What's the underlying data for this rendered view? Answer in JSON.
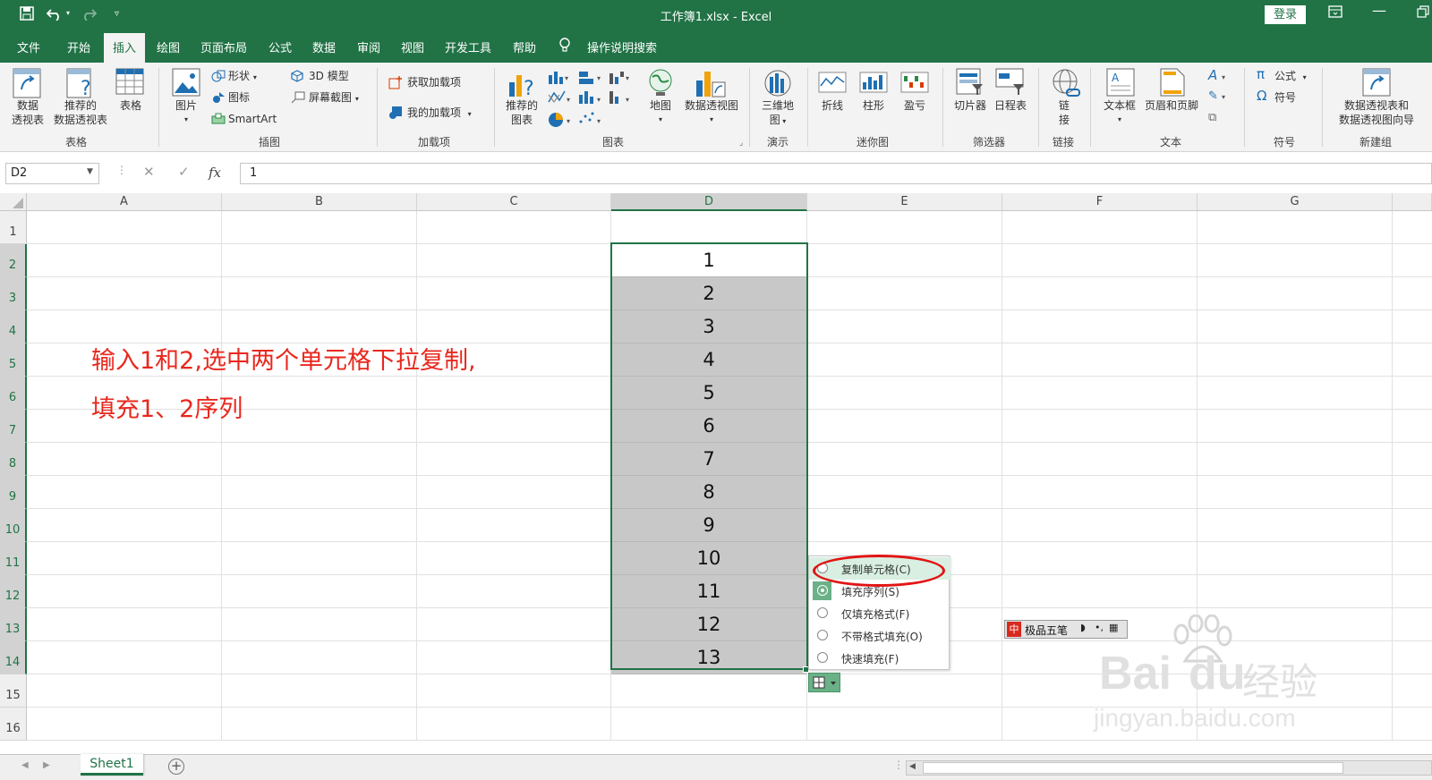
{
  "window": {
    "title": "工作簿1.xlsx  -  Excel",
    "login": "登录",
    "save_icon": "save-icon",
    "undo_icon": "undo-icon",
    "redo_icon": "redo-icon",
    "customize_icon": "customize-qat-icon"
  },
  "menu": {
    "tabs": [
      "文件",
      "开始",
      "插入",
      "绘图",
      "页面布局",
      "公式",
      "数据",
      "审阅",
      "视图",
      "开发工具",
      "帮助"
    ],
    "active": "插入",
    "tellme": "操作说明搜索"
  },
  "ribbon": {
    "groups": {
      "tables": "表格",
      "illustrations": "插图",
      "addins": "加载项",
      "charts": "图表",
      "tours": "演示",
      "sparklines": "迷你图",
      "filters": "筛选器",
      "links": "链接",
      "text": "文本",
      "symbols": "符号",
      "new_group": "新建组"
    },
    "pivot_table": [
      "数据",
      "透视表"
    ],
    "recommended_pivot": [
      "推荐的",
      "数据透视表"
    ],
    "table": "表格",
    "picture": "图片",
    "shapes": "形状",
    "icons": "图标",
    "smartart": "SmartArt",
    "model3d": "3D 模型",
    "screenshot": "屏幕截图",
    "get_addins": "获取加载项",
    "my_addins": "我的加载项",
    "recommended_charts": [
      "推荐的",
      "图表"
    ],
    "map": "地图",
    "pivot_chart": "数据透视图",
    "map3d": [
      "三维地",
      "图"
    ],
    "line": "折线",
    "column": "柱形",
    "winloss": "盈亏",
    "slicer": "切片器",
    "timeline": "日程表",
    "link": [
      "链",
      "接"
    ],
    "textbox": "文本框",
    "header_footer": "页眉和页脚",
    "equation": "公式",
    "symbol": "符号",
    "pivot_wizard": [
      "数据透视表和",
      "数据透视图向导"
    ]
  },
  "formula_bar": {
    "name_box": "D2",
    "cancel": "✕",
    "enter": "✓",
    "fx": "fx",
    "value": "1"
  },
  "grid": {
    "columns": [
      "A",
      "B",
      "C",
      "D",
      "E",
      "F",
      "G"
    ],
    "selected_column": "D",
    "rows": [
      "1",
      "2",
      "3",
      "4",
      "5",
      "6",
      "7",
      "8",
      "9",
      "10",
      "11",
      "12",
      "13",
      "14",
      "15",
      "16"
    ],
    "d_values": [
      "1",
      "2",
      "3",
      "4",
      "5",
      "6",
      "7",
      "8",
      "9",
      "10",
      "11",
      "12",
      "13"
    ]
  },
  "annotation": {
    "line1": "输入1和2,选中两个单元格下拉复制,",
    "line2": "填充1、2序列",
    "color": "#e8281e"
  },
  "autofill_menu": {
    "items": [
      "复制单元格(C)",
      "填充序列(S)",
      "仅填充格式(F)",
      "不带格式填充(O)",
      "快速填充(F)"
    ],
    "selected_index": 1,
    "highlighted_index": 0
  },
  "ime": {
    "label": "极品五笔",
    "mode": "中"
  },
  "watermark": {
    "brand": "Bai",
    "brand2": "du",
    "cn": "经验",
    "url": "jingyan.baidu.com"
  },
  "sheets": {
    "tabs": [
      "Sheet1"
    ],
    "add": "+"
  },
  "colors": {
    "accent": "#217346",
    "selection_fill": "#c8c8c8",
    "highlight_ring": "#e21414"
  }
}
